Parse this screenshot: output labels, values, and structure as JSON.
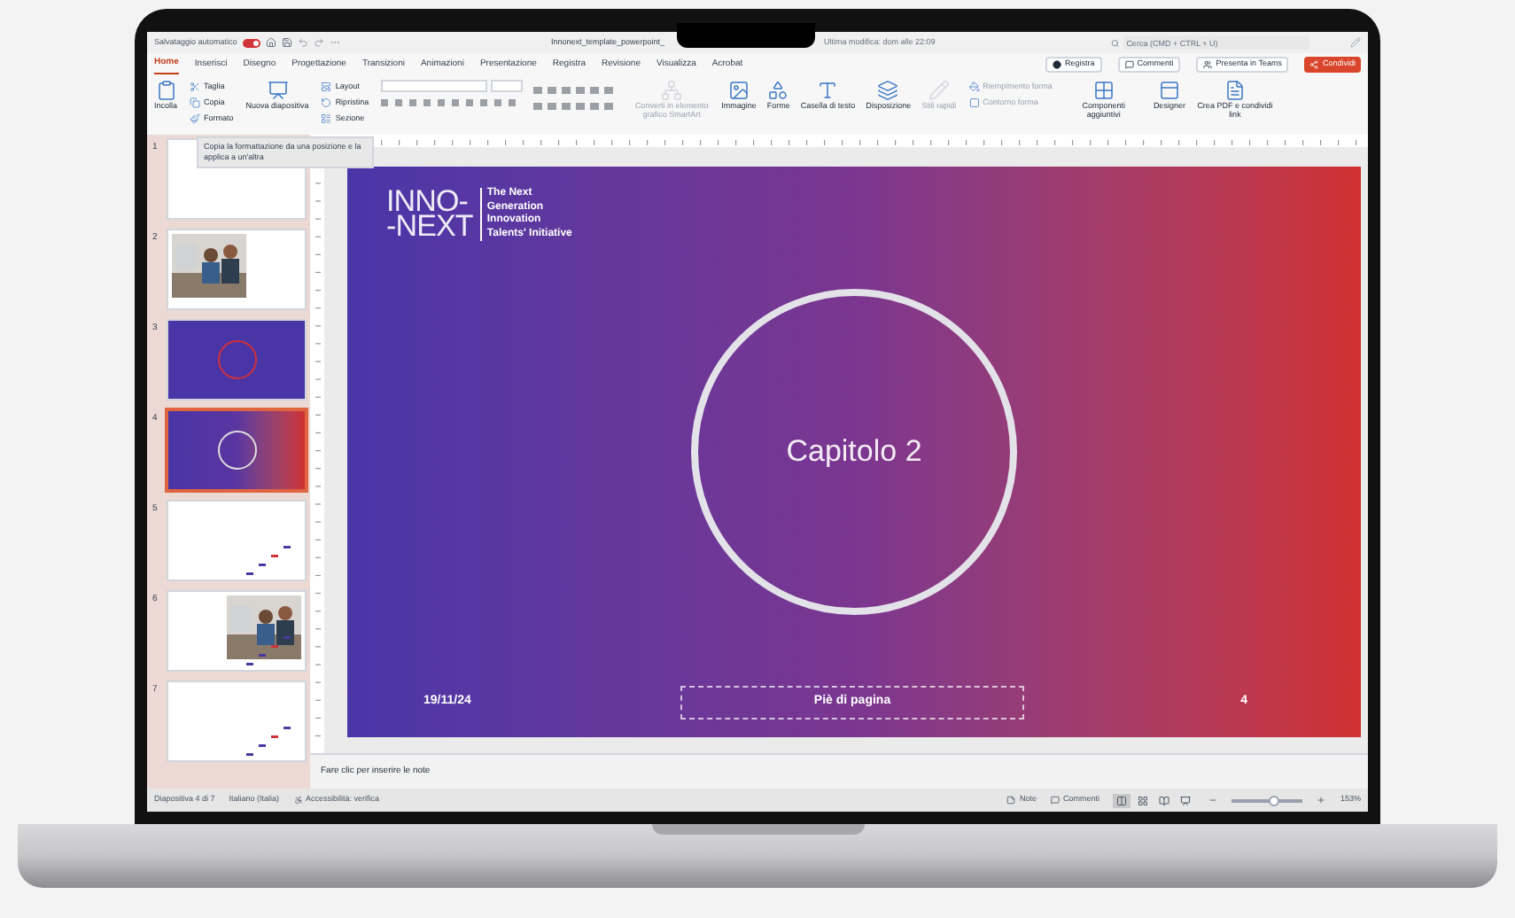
{
  "title_bar": {
    "autosave_label": "Salvataggio automatico",
    "autosave_on": true,
    "file_name": "Innonext_template_powerpoint_",
    "last_modified": "Ultima modifica: dom alle 22:09",
    "search": {
      "placeholder": "Cerca (CMD + CTRL + U)"
    }
  },
  "tabs": [
    {
      "label": "Home",
      "selected": true
    },
    {
      "label": "Inserisci",
      "selected": false
    },
    {
      "label": "Disegno",
      "selected": false
    },
    {
      "label": "Progettazione",
      "selected": false
    },
    {
      "label": "Transizioni",
      "selected": false
    },
    {
      "label": "Animazioni",
      "selected": false
    },
    {
      "label": "Presentazione",
      "selected": false
    },
    {
      "label": "Registra",
      "selected": false
    },
    {
      "label": "Revisione",
      "selected": false
    },
    {
      "label": "Visualizza",
      "selected": false
    },
    {
      "label": "Acrobat",
      "selected": false
    }
  ],
  "actions": [
    {
      "label": "Registra",
      "kind": "record"
    },
    {
      "label": "Commenti",
      "kind": "comments"
    },
    {
      "label": "Presenta in Teams",
      "kind": "teams"
    },
    {
      "label": "Condividi",
      "kind": "share"
    }
  ],
  "ribbon": [
    {
      "kind": "large",
      "label": "Incolla",
      "disabled": false
    },
    {
      "kind": "stack",
      "entries": [
        {
          "label": "Taglia",
          "disabled": false
        },
        {
          "label": "Copia",
          "disabled": false
        },
        {
          "label": "Formato",
          "disabled": false
        }
      ]
    },
    {
      "kind": "large",
      "label": "Nuova diapositiva",
      "disabled": false
    },
    {
      "kind": "stack",
      "entries": [
        {
          "label": "Layout",
          "disabled": false
        },
        {
          "label": "Ripristina",
          "disabled": false
        },
        {
          "label": "Sezione",
          "disabled": false
        }
      ]
    },
    {
      "kind": "font"
    },
    {
      "kind": "large",
      "label": "Converti in elemento grafico SmartArt",
      "disabled": true
    },
    {
      "kind": "large",
      "label": "Immagine",
      "disabled": false
    },
    {
      "kind": "large",
      "label": "Forme",
      "disabled": false
    },
    {
      "kind": "large",
      "label": "Casella di testo",
      "disabled": false
    },
    {
      "kind": "large",
      "label": "Disposizione",
      "disabled": false
    },
    {
      "kind": "large",
      "label": "Stili rapidi",
      "disabled": true
    },
    {
      "kind": "stack",
      "entries": [
        {
          "label": "Riempimento forma",
          "disabled": true
        },
        {
          "label": "Contorno forma",
          "disabled": true
        }
      ]
    },
    {
      "kind": "large",
      "label": "Componenti aggiuntivi",
      "disabled": false
    },
    {
      "kind": "large",
      "label": "Designer",
      "disabled": false
    },
    {
      "kind": "large",
      "label": "Crea PDF e condividi link",
      "disabled": false
    }
  ],
  "tooltip": "Copia la formattazione da una posizione e la applica a un'altra",
  "thumbnails": [
    {
      "number": "1",
      "kind": "white",
      "selected": false
    },
    {
      "number": "2",
      "selected": false
    },
    {
      "number": "3",
      "kind": "purple",
      "selected": false
    },
    {
      "number": "4",
      "kind": "gradient",
      "selected": true
    },
    {
      "number": "5",
      "kind": "pattern",
      "selected": false
    },
    {
      "number": "6",
      "kind": "photo-pattern",
      "selected": false
    },
    {
      "number": "7",
      "kind": "pattern",
      "selected": false
    }
  ],
  "slide": {
    "logo_top": "INNO-",
    "logo_bottom": "-NEXT",
    "tagline": [
      "The Next",
      "Generation",
      "Innovation",
      "Talents' Initiative"
    ],
    "circle_text": "Capitolo 2",
    "date": "19/11/24",
    "footer": "Piè di pagina",
    "page_number": "4"
  },
  "notes_placeholder": "Fare clic per inserire le note",
  "status_bar": {
    "slide": "Diapositiva 4 di 7",
    "language": "Italiano (Italia)",
    "accessibility": "Accessibilità: verifica",
    "notes": "Note",
    "comments": "Commenti",
    "views": [
      {
        "selected": true
      },
      {
        "selected": false
      },
      {
        "selected": false
      },
      {
        "selected": false
      }
    ],
    "zoom": {
      "level": 0.6
    },
    "zoom_value": "153%"
  }
}
